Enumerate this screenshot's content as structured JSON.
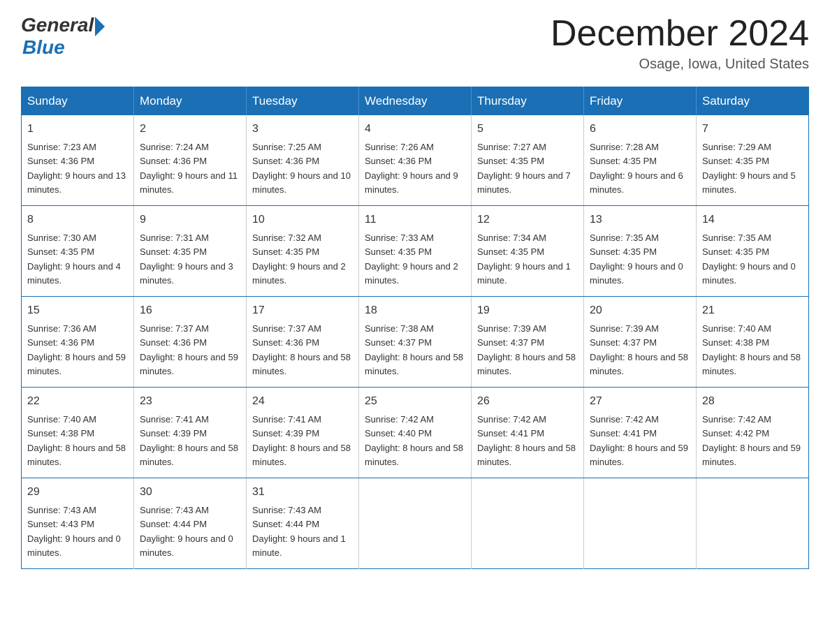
{
  "logo": {
    "general": "General",
    "blue": "Blue"
  },
  "header": {
    "month_title": "December 2024",
    "location": "Osage, Iowa, United States"
  },
  "weekdays": [
    "Sunday",
    "Monday",
    "Tuesday",
    "Wednesday",
    "Thursday",
    "Friday",
    "Saturday"
  ],
  "weeks": [
    [
      {
        "day": "1",
        "sunrise": "7:23 AM",
        "sunset": "4:36 PM",
        "daylight": "9 hours and 13 minutes."
      },
      {
        "day": "2",
        "sunrise": "7:24 AM",
        "sunset": "4:36 PM",
        "daylight": "9 hours and 11 minutes."
      },
      {
        "day": "3",
        "sunrise": "7:25 AM",
        "sunset": "4:36 PM",
        "daylight": "9 hours and 10 minutes."
      },
      {
        "day": "4",
        "sunrise": "7:26 AM",
        "sunset": "4:36 PM",
        "daylight": "9 hours and 9 minutes."
      },
      {
        "day": "5",
        "sunrise": "7:27 AM",
        "sunset": "4:35 PM",
        "daylight": "9 hours and 7 minutes."
      },
      {
        "day": "6",
        "sunrise": "7:28 AM",
        "sunset": "4:35 PM",
        "daylight": "9 hours and 6 minutes."
      },
      {
        "day": "7",
        "sunrise": "7:29 AM",
        "sunset": "4:35 PM",
        "daylight": "9 hours and 5 minutes."
      }
    ],
    [
      {
        "day": "8",
        "sunrise": "7:30 AM",
        "sunset": "4:35 PM",
        "daylight": "9 hours and 4 minutes."
      },
      {
        "day": "9",
        "sunrise": "7:31 AM",
        "sunset": "4:35 PM",
        "daylight": "9 hours and 3 minutes."
      },
      {
        "day": "10",
        "sunrise": "7:32 AM",
        "sunset": "4:35 PM",
        "daylight": "9 hours and 2 minutes."
      },
      {
        "day": "11",
        "sunrise": "7:33 AM",
        "sunset": "4:35 PM",
        "daylight": "9 hours and 2 minutes."
      },
      {
        "day": "12",
        "sunrise": "7:34 AM",
        "sunset": "4:35 PM",
        "daylight": "9 hours and 1 minute."
      },
      {
        "day": "13",
        "sunrise": "7:35 AM",
        "sunset": "4:35 PM",
        "daylight": "9 hours and 0 minutes."
      },
      {
        "day": "14",
        "sunrise": "7:35 AM",
        "sunset": "4:35 PM",
        "daylight": "9 hours and 0 minutes."
      }
    ],
    [
      {
        "day": "15",
        "sunrise": "7:36 AM",
        "sunset": "4:36 PM",
        "daylight": "8 hours and 59 minutes."
      },
      {
        "day": "16",
        "sunrise": "7:37 AM",
        "sunset": "4:36 PM",
        "daylight": "8 hours and 59 minutes."
      },
      {
        "day": "17",
        "sunrise": "7:37 AM",
        "sunset": "4:36 PM",
        "daylight": "8 hours and 58 minutes."
      },
      {
        "day": "18",
        "sunrise": "7:38 AM",
        "sunset": "4:37 PM",
        "daylight": "8 hours and 58 minutes."
      },
      {
        "day": "19",
        "sunrise": "7:39 AM",
        "sunset": "4:37 PM",
        "daylight": "8 hours and 58 minutes."
      },
      {
        "day": "20",
        "sunrise": "7:39 AM",
        "sunset": "4:37 PM",
        "daylight": "8 hours and 58 minutes."
      },
      {
        "day": "21",
        "sunrise": "7:40 AM",
        "sunset": "4:38 PM",
        "daylight": "8 hours and 58 minutes."
      }
    ],
    [
      {
        "day": "22",
        "sunrise": "7:40 AM",
        "sunset": "4:38 PM",
        "daylight": "8 hours and 58 minutes."
      },
      {
        "day": "23",
        "sunrise": "7:41 AM",
        "sunset": "4:39 PM",
        "daylight": "8 hours and 58 minutes."
      },
      {
        "day": "24",
        "sunrise": "7:41 AM",
        "sunset": "4:39 PM",
        "daylight": "8 hours and 58 minutes."
      },
      {
        "day": "25",
        "sunrise": "7:42 AM",
        "sunset": "4:40 PM",
        "daylight": "8 hours and 58 minutes."
      },
      {
        "day": "26",
        "sunrise": "7:42 AM",
        "sunset": "4:41 PM",
        "daylight": "8 hours and 58 minutes."
      },
      {
        "day": "27",
        "sunrise": "7:42 AM",
        "sunset": "4:41 PM",
        "daylight": "8 hours and 59 minutes."
      },
      {
        "day": "28",
        "sunrise": "7:42 AM",
        "sunset": "4:42 PM",
        "daylight": "8 hours and 59 minutes."
      }
    ],
    [
      {
        "day": "29",
        "sunrise": "7:43 AM",
        "sunset": "4:43 PM",
        "daylight": "9 hours and 0 minutes."
      },
      {
        "day": "30",
        "sunrise": "7:43 AM",
        "sunset": "4:44 PM",
        "daylight": "9 hours and 0 minutes."
      },
      {
        "day": "31",
        "sunrise": "7:43 AM",
        "sunset": "4:44 PM",
        "daylight": "9 hours and 1 minute."
      },
      null,
      null,
      null,
      null
    ]
  ],
  "labels": {
    "sunrise": "Sunrise:",
    "sunset": "Sunset:",
    "daylight": "Daylight:"
  }
}
